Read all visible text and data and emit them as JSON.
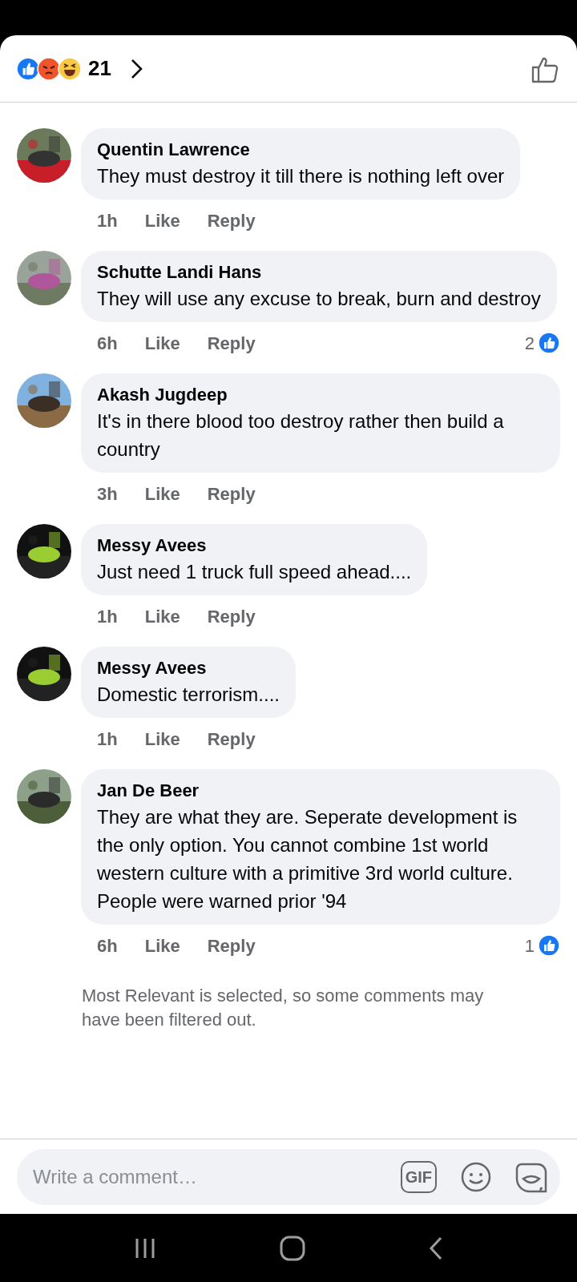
{
  "header": {
    "reaction_count": "21"
  },
  "comments": [
    {
      "author": "Quentin Lawrence",
      "text": "They must destroy it till there is nothing left over",
      "time": "1h",
      "like": "Like",
      "reply": "Reply"
    },
    {
      "author": "Schutte Landi Hans",
      "text": "They will use any excuse to break, burn and destroy",
      "time": "6h",
      "like": "Like",
      "reply": "Reply",
      "reactions": "2"
    },
    {
      "author": "Akash Jugdeep",
      "text": "It's in there blood too destroy rather then build a country",
      "time": "3h",
      "like": "Like",
      "reply": "Reply"
    },
    {
      "author": "Messy Avees",
      "text": "Just need 1 truck full speed ahead....",
      "time": "1h",
      "like": "Like",
      "reply": "Reply"
    },
    {
      "author": "Messy Avees",
      "text": "Domestic terrorism....",
      "time": "1h",
      "like": "Like",
      "reply": "Reply"
    },
    {
      "author": "Jan De Beer",
      "text": "They are what they are. Seperate development is the only option. You cannot combine 1st world western culture with a primitive 3rd world culture.  People were warned prior '94",
      "time": "6h",
      "like": "Like",
      "reply": "Reply",
      "reactions": "1"
    }
  ],
  "filter_note": "Most Relevant is selected, so some comments may have been filtered out.",
  "composer": {
    "placeholder": "Write a comment…",
    "gif_label": "GIF"
  }
}
